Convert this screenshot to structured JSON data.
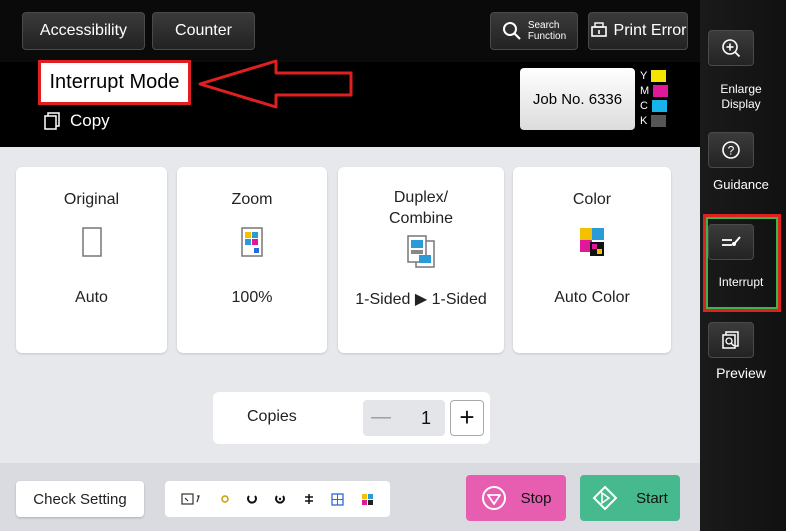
{
  "topbar": {
    "accessibility_label": "Accessibility",
    "counter_label": "Counter",
    "search_label_line1": "Search",
    "search_label_line2": "Function",
    "print_error_label": "Print Error"
  },
  "header": {
    "mode_label": "Interrupt Mode",
    "function_label": "Copy",
    "job_label": "Job No. 6336",
    "toner": [
      {
        "letter": "Y",
        "color": "#f2e600"
      },
      {
        "letter": "M",
        "color": "#e0199a"
      },
      {
        "letter": "C",
        "color": "#16b2e8"
      },
      {
        "letter": "K",
        "color": "#555555"
      }
    ]
  },
  "cards": {
    "original": {
      "title": "Original",
      "value": "Auto"
    },
    "zoom": {
      "title": "Zoom",
      "value": "100%"
    },
    "duplex": {
      "title_line1": "Duplex/",
      "title_line2": "Combine",
      "value": "1-Sided ▶ 1-Sided"
    },
    "color": {
      "title": "Color",
      "value": "Auto Color"
    }
  },
  "copies": {
    "label": "Copies",
    "minus": "—",
    "value": "1",
    "plus": "+"
  },
  "bottom": {
    "check_setting_label": "Check Setting",
    "stop_label": "Stop",
    "start_label": "Start"
  },
  "side": {
    "enlarge_line1": "Enlarge",
    "enlarge_line2": "Display",
    "guidance_label": "Guidance",
    "interrupt_label": "Interrupt",
    "preview_label": "Preview"
  },
  "colors": {
    "annotation_red": "#e02020",
    "annotation_green": "#3ab54a",
    "stop": "#e75db0",
    "start": "#46b98e"
  }
}
